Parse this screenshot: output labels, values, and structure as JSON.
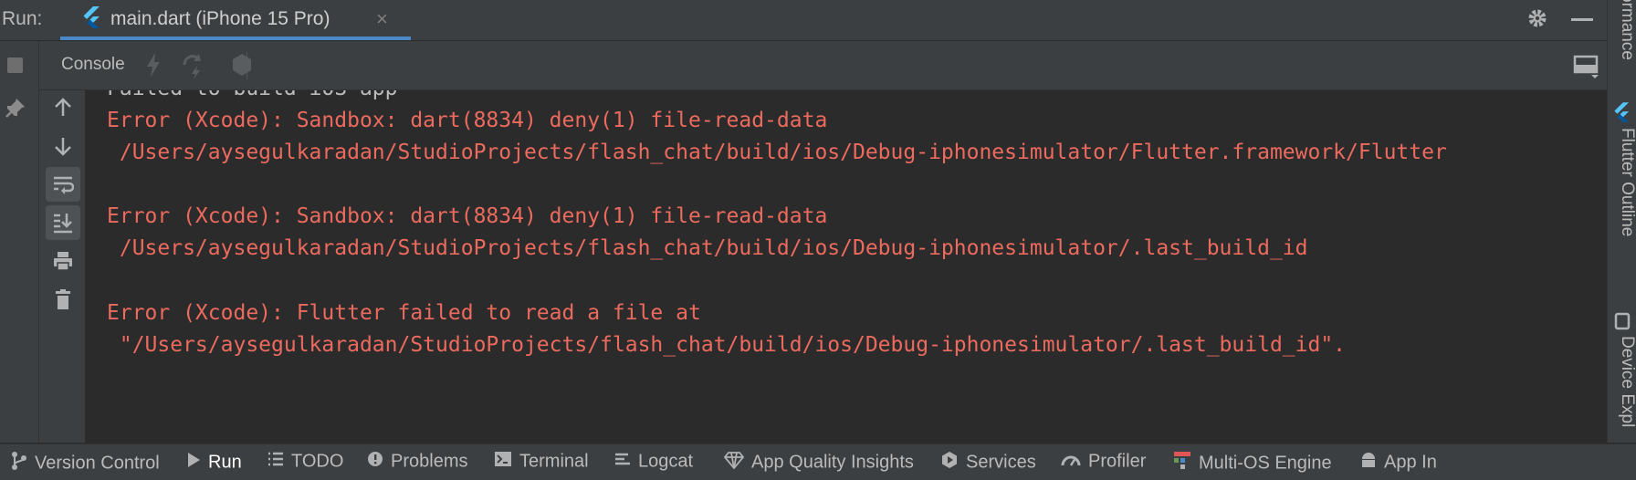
{
  "run_bar": {
    "label": "Run:",
    "tab": {
      "label": "main.dart (iPhone 15 Pro)",
      "close": "×"
    }
  },
  "console": {
    "tab_label": "Console"
  },
  "output": {
    "lines": [
      {
        "text": "Failed to build iOS app",
        "kind": "normal"
      },
      {
        "text": "Error (Xcode): Sandbox: dart(8834) deny(1) file-read-data",
        "kind": "err"
      },
      {
        "text": " /Users/aysegulkaradan/StudioProjects/flash_chat/build/ios/Debug-iphonesimulator/Flutter.framework/Flutter",
        "kind": "err"
      },
      {
        "text": "",
        "kind": "err"
      },
      {
        "text": "Error (Xcode): Sandbox: dart(8834) deny(1) file-read-data",
        "kind": "err"
      },
      {
        "text": " /Users/aysegulkaradan/StudioProjects/flash_chat/build/ios/Debug-iphonesimulator/.last_build_id",
        "kind": "err"
      },
      {
        "text": "",
        "kind": "err"
      },
      {
        "text": "Error (Xcode): Flutter failed to read a file at",
        "kind": "err"
      },
      {
        "text": " \"/Users/aysegulkaradan/StudioProjects/flash_chat/build/ios/Debug-iphonesimulator/.last_build_id\".",
        "kind": "err"
      }
    ]
  },
  "right_sidebar": {
    "items": [
      "ormance",
      "Flutter Outline",
      "Device Expl"
    ]
  },
  "bottom_bar": {
    "items": [
      {
        "label": "Version Control",
        "icon": "branch-icon"
      },
      {
        "label": "Run",
        "icon": "play-icon"
      },
      {
        "label": "TODO",
        "icon": "list-icon"
      },
      {
        "label": "Problems",
        "icon": "warning-icon"
      },
      {
        "label": "Terminal",
        "icon": "terminal-icon"
      },
      {
        "label": "Logcat",
        "icon": "logcat-icon"
      },
      {
        "label": "App Quality Insights",
        "icon": "diamond-icon"
      },
      {
        "label": "Services",
        "icon": "services-icon"
      },
      {
        "label": "Profiler",
        "icon": "gauge-icon"
      },
      {
        "label": "Multi-OS Engine",
        "icon": "hierarchy-icon"
      },
      {
        "label": "App In",
        "icon": "android-icon"
      }
    ]
  },
  "colors": {
    "error_text": "#ec6a5e",
    "normal_text": "#bbbbbb",
    "tab_underline": "#4a88c7",
    "panel_bg": "#3c3f41",
    "console_bg": "#2b2b2b"
  }
}
